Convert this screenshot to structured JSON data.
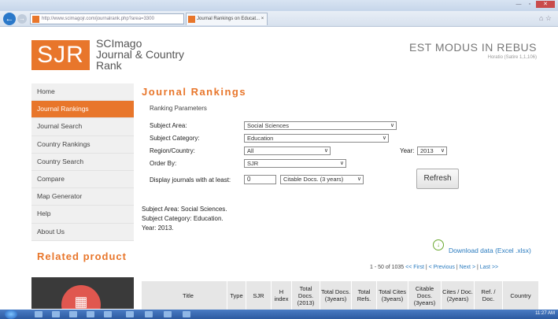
{
  "browser": {
    "url": "http://www.scimagojr.com/journalrank.php?area=3300",
    "tab_title": "Journal Rankings on Educat... ×",
    "window_close": "✕",
    "window_min": "—",
    "window_max": "▫"
  },
  "header": {
    "logo": "SJR",
    "logo_line1": "SCImago",
    "logo_line2": "Journal & Country",
    "logo_line3": "Rank",
    "motto": "EST MODUS IN REBUS",
    "motto_source": "Horatio (Satire 1,1,106)"
  },
  "sidebar": {
    "items": [
      {
        "label": "Home"
      },
      {
        "label": "Journal Rankings"
      },
      {
        "label": "Journal Search"
      },
      {
        "label": "Country Rankings"
      },
      {
        "label": "Country Search"
      },
      {
        "label": "Compare"
      },
      {
        "label": "Map Generator"
      },
      {
        "label": "Help"
      },
      {
        "label": "About Us"
      }
    ],
    "related_title": "Related product"
  },
  "main": {
    "title": "Journal Rankings",
    "params_label": "Ranking Parameters",
    "subject_area_label": "Subject Area:",
    "subject_area_value": "Social Sciences",
    "subject_category_label": "Subject Category:",
    "subject_category_value": "Education",
    "region_label": "Region/Country:",
    "region_value": "All",
    "year_label": "Year:",
    "year_value": "2013",
    "order_label": "Order By:",
    "order_value": "SJR",
    "display_label": "Display journals with at least:",
    "display_count": "0",
    "display_type": "Citable Docs. (3 years)",
    "refresh_label": "Refresh",
    "summary_area": "Subject Area: Social Sciences.",
    "summary_category": "Subject Category: Education.",
    "summary_year": "Year: 2013.",
    "download_label": "Download data (Excel .xlsx)",
    "pager_range": "1 - 50 of 1035",
    "pager_first": "<< First",
    "pager_prev": "< Previous",
    "pager_next": "Next >",
    "pager_last": "Last >>"
  },
  "table": {
    "headers": [
      "Title",
      "Type",
      "SJR",
      "H index",
      "Total Docs. (2013)",
      "Total Docs. (3years)",
      "Total Refs.",
      "Total Cites (3years)",
      "Citable Docs. (3years)",
      "Cites / Doc. (2years)",
      "Ref. / Doc.",
      "Country"
    ]
  },
  "taskbar": {
    "clock": "11:27 AM"
  }
}
